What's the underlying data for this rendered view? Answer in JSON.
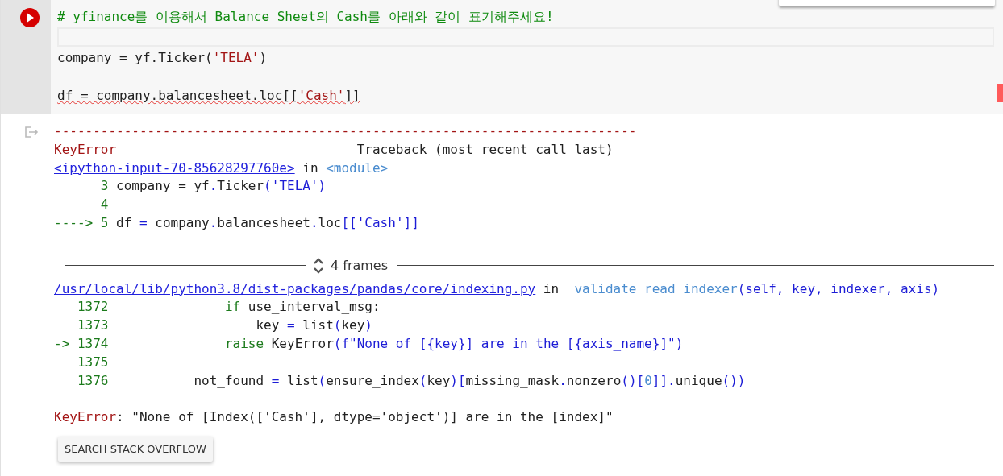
{
  "input": {
    "lines": [
      {
        "kind": "code",
        "spell_error": false,
        "tokens": [
          {
            "t": "# yfinance를 이용해서 Balance Sheet의 Cash를 아래와 같이 표기해주세요!",
            "kind": "comment"
          }
        ]
      },
      {
        "kind": "field"
      },
      {
        "kind": "code",
        "spell_error": false,
        "tokens": [
          {
            "t": "company = yf.Ticker(",
            "kind": "plain"
          },
          {
            "t": "'TELA'",
            "kind": "string"
          },
          {
            "t": ")",
            "kind": "plain"
          }
        ]
      },
      {
        "kind": "blank"
      },
      {
        "kind": "code",
        "spell_error": true,
        "tokens": [
          {
            "t": "df = company.balancesheet.loc[[",
            "kind": "plain"
          },
          {
            "t": "'Cash'",
            "kind": "string"
          },
          {
            "t": "]]",
            "kind": "plain"
          }
        ]
      }
    ]
  },
  "output": {
    "lines": [
      {
        "kind": "code",
        "tokens": [
          {
            "t": "---------------------------------------------------------------------------",
            "kind": "error"
          }
        ]
      },
      {
        "kind": "code",
        "tokens": [
          {
            "t": "KeyError",
            "kind": "error"
          },
          {
            "t": "                               Traceback (most recent call last)",
            "kind": "plain"
          }
        ]
      },
      {
        "kind": "code",
        "tokens": [
          {
            "t": "<ipython-input-70-85628297760e>",
            "kind": "link"
          },
          {
            "t": " in ",
            "kind": "plain"
          },
          {
            "t": "<module>",
            "kind": "module"
          }
        ]
      },
      {
        "kind": "code",
        "tokens": [
          {
            "t": "      3",
            "kind": "num"
          },
          {
            "t": " company = yf",
            "kind": "plain"
          },
          {
            "t": ".",
            "kind": "op"
          },
          {
            "t": "Ticker",
            "kind": "plain"
          },
          {
            "t": "('TELA')",
            "kind": "op"
          }
        ]
      },
      {
        "kind": "code",
        "tokens": [
          {
            "t": "      4",
            "kind": "num"
          }
        ]
      },
      {
        "kind": "code",
        "tokens": [
          {
            "t": "----> 5",
            "kind": "num"
          },
          {
            "t": " df ",
            "kind": "plain"
          },
          {
            "t": "=",
            "kind": "op"
          },
          {
            "t": " company",
            "kind": "plain"
          },
          {
            "t": ".",
            "kind": "op"
          },
          {
            "t": "balancesheet",
            "kind": "plain"
          },
          {
            "t": ".",
            "kind": "op"
          },
          {
            "t": "loc",
            "kind": "plain"
          },
          {
            "t": "[['Cash']]",
            "kind": "op"
          }
        ]
      },
      {
        "kind": "blank"
      },
      {
        "kind": "frames",
        "label": "4 frames"
      },
      {
        "kind": "code",
        "tokens": [
          {
            "t": "/usr/local/lib/python3.8/dist-packages/pandas/core/indexing.py",
            "kind": "link"
          },
          {
            "t": " in ",
            "kind": "plain"
          },
          {
            "t": "_validate_read_indexer",
            "kind": "module"
          },
          {
            "t": "(self, key, indexer, axis)",
            "kind": "op"
          }
        ]
      },
      {
        "kind": "code",
        "tokens": [
          {
            "t": "   1372               if",
            "kind": "num"
          },
          {
            "t": " use_interval_msg:",
            "kind": "plain"
          }
        ]
      },
      {
        "kind": "code",
        "tokens": [
          {
            "t": "   1373",
            "kind": "num"
          },
          {
            "t": "                   key ",
            "kind": "plain"
          },
          {
            "t": "=",
            "kind": "op"
          },
          {
            "t": " list",
            "kind": "plain"
          },
          {
            "t": "(",
            "kind": "op"
          },
          {
            "t": "key",
            "kind": "plain"
          },
          {
            "t": ")",
            "kind": "op"
          }
        ]
      },
      {
        "kind": "code",
        "tokens": [
          {
            "t": "-> 1374               raise",
            "kind": "num"
          },
          {
            "t": " KeyError",
            "kind": "plain"
          },
          {
            "t": "(f\"None of [{key}] are in the [{axis_name}]\")",
            "kind": "op"
          }
        ]
      },
      {
        "kind": "code",
        "tokens": [
          {
            "t": "   1375",
            "kind": "num"
          }
        ]
      },
      {
        "kind": "code",
        "tokens": [
          {
            "t": "   1376",
            "kind": "num"
          },
          {
            "t": "           not_found ",
            "kind": "plain"
          },
          {
            "t": "=",
            "kind": "op"
          },
          {
            "t": " list",
            "kind": "plain"
          },
          {
            "t": "(",
            "kind": "op"
          },
          {
            "t": "ensure_index",
            "kind": "plain"
          },
          {
            "t": "(",
            "kind": "op"
          },
          {
            "t": "key",
            "kind": "plain"
          },
          {
            "t": ")[",
            "kind": "op"
          },
          {
            "t": "missing_mask",
            "kind": "plain"
          },
          {
            "t": ".",
            "kind": "op"
          },
          {
            "t": "nonzero",
            "kind": "plain"
          },
          {
            "t": "()[",
            "kind": "op"
          },
          {
            "t": "0",
            "kind": "module"
          },
          {
            "t": "]].",
            "kind": "op"
          },
          {
            "t": "unique",
            "kind": "plain"
          },
          {
            "t": "())",
            "kind": "op"
          }
        ]
      },
      {
        "kind": "blank"
      },
      {
        "kind": "code",
        "tokens": [
          {
            "t": "KeyError",
            "kind": "error"
          },
          {
            "t": ": \"None of [Index(['Cash'], dtype='object')] are in the [index]\"",
            "kind": "plain"
          }
        ]
      }
    ]
  },
  "search_button": "SEARCH STACK OVERFLOW"
}
